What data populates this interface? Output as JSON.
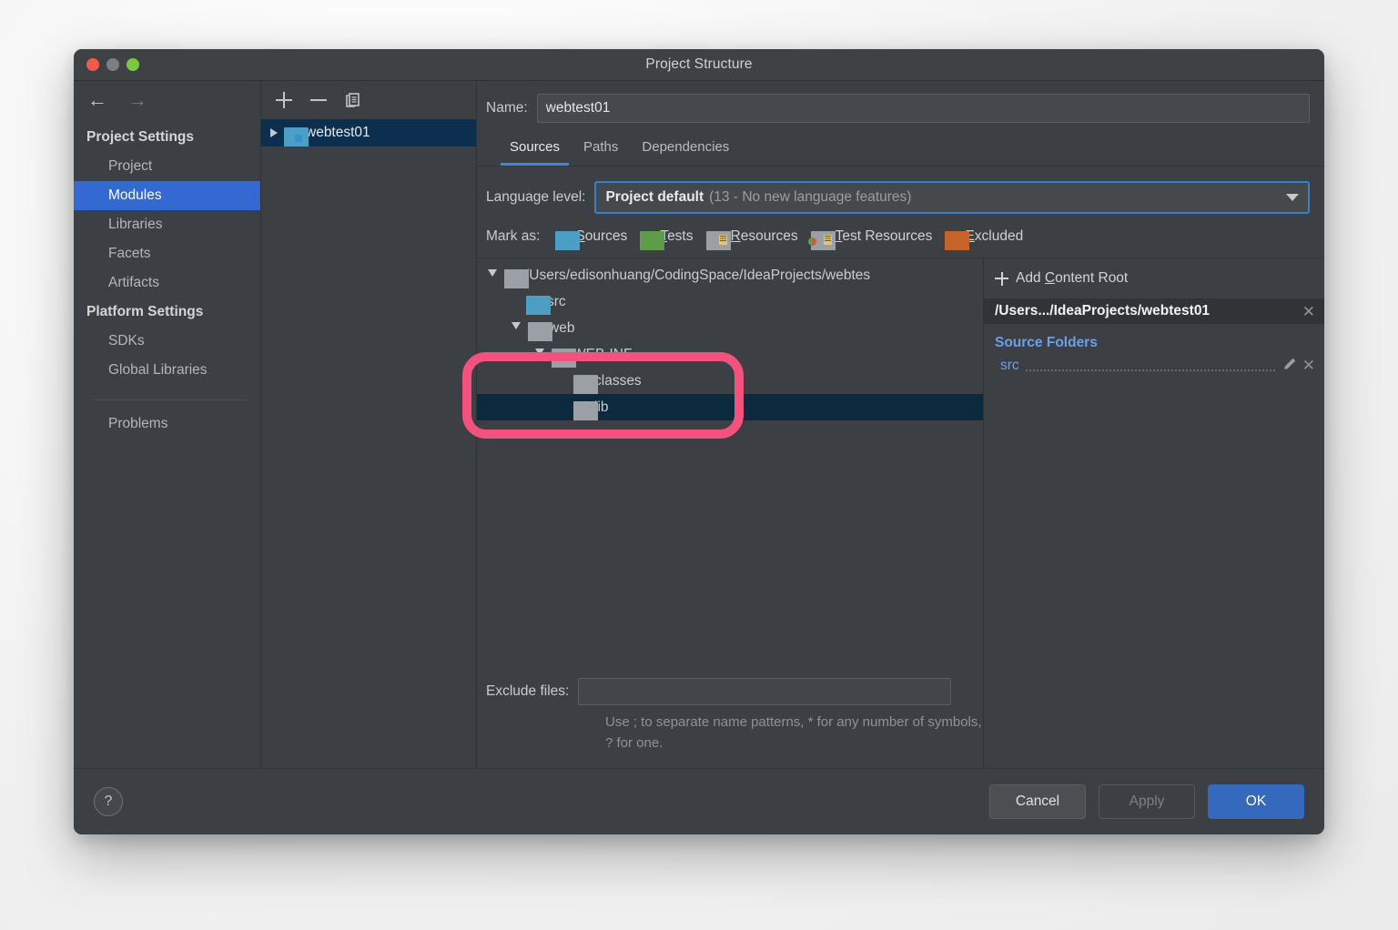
{
  "window": {
    "title": "Project Structure",
    "traffic_lights": [
      "close-red",
      "minimize-gray",
      "zoom-green"
    ],
    "accent_blue": "#3469d1",
    "annotation_color": "#f4527e"
  },
  "nav": {
    "back_icon": "arrow-left-icon",
    "forward_icon": "arrow-right-icon"
  },
  "sidebar": {
    "groups": [
      {
        "label": "Project Settings",
        "items": [
          {
            "label": "Project",
            "active": false
          },
          {
            "label": "Modules",
            "active": true
          },
          {
            "label": "Libraries",
            "active": false
          },
          {
            "label": "Facets",
            "active": false
          },
          {
            "label": "Artifacts",
            "active": false
          }
        ]
      },
      {
        "label": "Platform Settings",
        "items": [
          {
            "label": "SDKs",
            "active": false
          },
          {
            "label": "Global Libraries",
            "active": false
          }
        ]
      }
    ],
    "problems_label": "Problems"
  },
  "module_list": {
    "toolbar": [
      {
        "icon": "plus-icon",
        "label": "Add"
      },
      {
        "icon": "minus-icon",
        "label": "Remove"
      },
      {
        "icon": "copy-icon",
        "label": "Copy"
      }
    ],
    "modules": [
      {
        "name": "webtest01",
        "selected": true,
        "expandable": true
      }
    ]
  },
  "main": {
    "name_label": "Name:",
    "name_value": "webtest01",
    "name_placeholder": "",
    "tabs": [
      {
        "label": "Sources",
        "active": true
      },
      {
        "label": "Paths",
        "active": false
      },
      {
        "label": "Dependencies",
        "active": false
      }
    ],
    "language_level": {
      "label": "Language level:",
      "value_main": "Project default",
      "value_sub": "(13 - No new language features)"
    },
    "mark_as": {
      "label": "Mark as:",
      "options": [
        {
          "label": "Sources",
          "mnemonic": "S",
          "rest": "ources",
          "icon": "folder-blue-icon"
        },
        {
          "label": "Tests",
          "mnemonic": "T",
          "rest": "ests",
          "icon": "folder-green-icon"
        },
        {
          "label": "Resources",
          "mnemonic": "R",
          "rest": "esources",
          "icon": "folder-resources-icon"
        },
        {
          "label": "Test Resources",
          "mnemonic": "T",
          "rest": "est Resources",
          "icon": "folder-test-resources-icon"
        },
        {
          "label": "Excluded",
          "mnemonic": "E",
          "rest": "xcluded",
          "icon": "folder-orange-icon"
        }
      ]
    },
    "tree": [
      {
        "name": "/Users/edisonhuang/CodingSpace/IdeaProjects/webtes",
        "depth": 0,
        "twist": "down",
        "folder": "gray",
        "selected": false
      },
      {
        "name": "src",
        "depth": 1,
        "twist": "none",
        "folder": "blue",
        "selected": false
      },
      {
        "name": "web",
        "depth": 1,
        "twist": "down",
        "folder": "gray",
        "selected": false
      },
      {
        "name": "WEB-INF",
        "depth": 2,
        "twist": "down",
        "folder": "gray",
        "selected": false
      },
      {
        "name": "classes",
        "depth": 3,
        "twist": "none",
        "folder": "gray",
        "selected": false
      },
      {
        "name": "lib",
        "depth": 3,
        "twist": "none",
        "folder": "gray",
        "selected": true
      }
    ],
    "exclude": {
      "label": "Exclude files:",
      "value": "",
      "placeholder": "",
      "hint": "Use ; to separate name patterns, * for any number of symbols, ? for one."
    }
  },
  "right_panel": {
    "add_content_root": {
      "prefix": "Add ",
      "mnemonic": "C",
      "rest": "ontent Root"
    },
    "content_root_path": "/Users.../IdeaProjects/webtest01",
    "source_folders_title": "Source Folders",
    "source_folders": [
      {
        "name": "src",
        "edit_icon": "pencil-icon",
        "remove_icon": "close-icon"
      }
    ],
    "remove_icon": "close-icon"
  },
  "footer": {
    "help_label": "?",
    "buttons": [
      {
        "label": "Cancel",
        "style": "secondary",
        "enabled": true
      },
      {
        "label": "Apply",
        "style": "ghost",
        "enabled": false
      },
      {
        "label": "OK",
        "style": "primary",
        "enabled": true
      }
    ]
  }
}
